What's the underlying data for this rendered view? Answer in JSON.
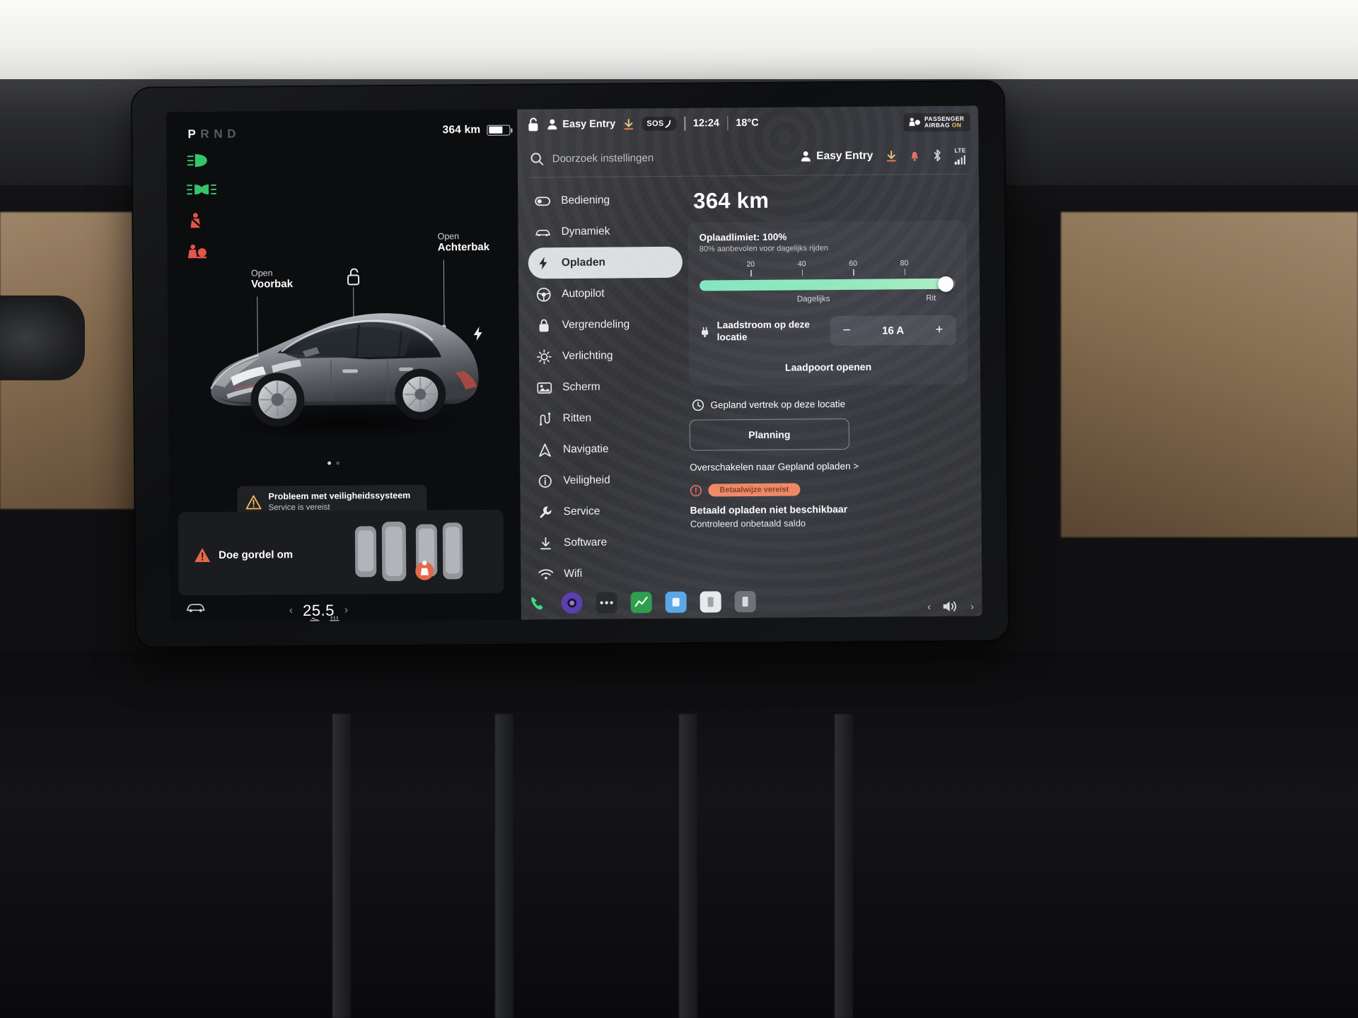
{
  "car_display": {
    "gear": {
      "letters": [
        "P",
        "R",
        "N",
        "D"
      ],
      "active_index": 0,
      "active_letter": "P"
    },
    "telltales": [
      {
        "name": "low-beam-headlight",
        "color": "#35c46a"
      },
      {
        "name": "front-fog-light",
        "color": "#35c46a"
      },
      {
        "name": "seatbelt-warning",
        "color": "#e4554a"
      },
      {
        "name": "airbag-warning",
        "color": "#e4554a"
      }
    ],
    "status": {
      "range": "364 km",
      "battery_percent": 62
    },
    "callouts": [
      {
        "sub": "Open",
        "main": "Voorbak"
      },
      {
        "sub": "Open",
        "main": "Achterbak"
      }
    ],
    "lock_state": "unlocked",
    "charge_port_icon": "charge-bolt-icon",
    "alerts": [
      {
        "title": "Probleem met veiligheidssysteem",
        "subtitle": "Service is vereist"
      }
    ],
    "seatbelt_card": {
      "label": "Doe gordel om"
    },
    "climate": {
      "temperature": "25.5"
    }
  },
  "settings": {
    "statusbar": {
      "range": "364 km",
      "profile": "Easy Entry",
      "sos": "SOS",
      "time": "12:24",
      "temperature": "18°C",
      "airbag": {
        "line1": "PASSENGER",
        "line2": "AIRBAG",
        "state": "ON"
      }
    },
    "search": {
      "placeholder": "Doorzoek instellingen"
    },
    "header": {
      "profile": "Easy Entry",
      "icons": [
        "download-icon",
        "bell-icon",
        "bluetooth-icon",
        "signal-icon"
      ],
      "network": "LTE"
    },
    "menu": [
      {
        "label": "Bediening",
        "icon": "toggle-icon",
        "active": false
      },
      {
        "label": "Dynamiek",
        "icon": "car-icon",
        "active": false
      },
      {
        "label": "Opladen",
        "icon": "bolt-icon",
        "active": true
      },
      {
        "label": "Autopilot",
        "icon": "steering-wheel-icon",
        "active": false
      },
      {
        "label": "Vergrendeling",
        "icon": "lock-icon",
        "active": false
      },
      {
        "label": "Verlichting",
        "icon": "sun-icon",
        "active": false
      },
      {
        "label": "Scherm",
        "icon": "display-icon",
        "active": false
      },
      {
        "label": "Ritten",
        "icon": "route-icon",
        "active": false
      },
      {
        "label": "Navigatie",
        "icon": "navigation-arrow-icon",
        "active": false
      },
      {
        "label": "Veiligheid",
        "icon": "shield-info-icon",
        "active": false
      },
      {
        "label": "Service",
        "icon": "wrench-icon",
        "active": false
      },
      {
        "label": "Software",
        "icon": "download-arrow-icon",
        "active": false
      },
      {
        "label": "Wifi",
        "icon": "wifi-icon",
        "active": false
      }
    ],
    "charging": {
      "range": "364 km",
      "limit_title": "Oplaadlimiet: 100%",
      "limit_subtitle": "80% aanbevolen voor dagelijks rijden",
      "limit_percent": 100,
      "slider_ticks": [
        "20",
        "40",
        "60",
        "80"
      ],
      "slider_tick_positions": [
        20,
        40,
        60,
        80
      ],
      "slider_zone_labels": {
        "daily": "Dagelijks",
        "trip": "Rit"
      },
      "amp_label": "Laadstroom op deze locatie",
      "amp_value": "16 A",
      "amp_minus": "−",
      "amp_plus": "+",
      "open_port": "Laadpoort openen",
      "scheduled_label": "Gepland vertrek op deze locatie",
      "plan_button": "Planning",
      "switch_link": "Overschakelen naar Gepland opladen >",
      "payment_pill": "Betaalwijze vereist",
      "payment_title": "Betaald opladen niet beschikbaar",
      "payment_sub": "Controleerd onbetaald saldo"
    }
  },
  "dock": {
    "items": [
      {
        "name": "phone-icon",
        "color": "#3ddc84"
      },
      {
        "name": "camera-icon",
        "color": "#5b3fb0"
      },
      {
        "name": "more-apps-icon",
        "color": "#2a2b2e"
      },
      {
        "name": "chart-app-icon",
        "color": "#2f9e4f"
      },
      {
        "name": "blue-app-icon",
        "color": "#5ba7e8"
      },
      {
        "name": "white-app-icon",
        "color": "#e8e9eb"
      },
      {
        "name": "grey-app-icon",
        "color": "#6f7276"
      }
    ],
    "volume": {
      "prev": "‹",
      "icon": "speaker-icon",
      "next": "›"
    }
  }
}
